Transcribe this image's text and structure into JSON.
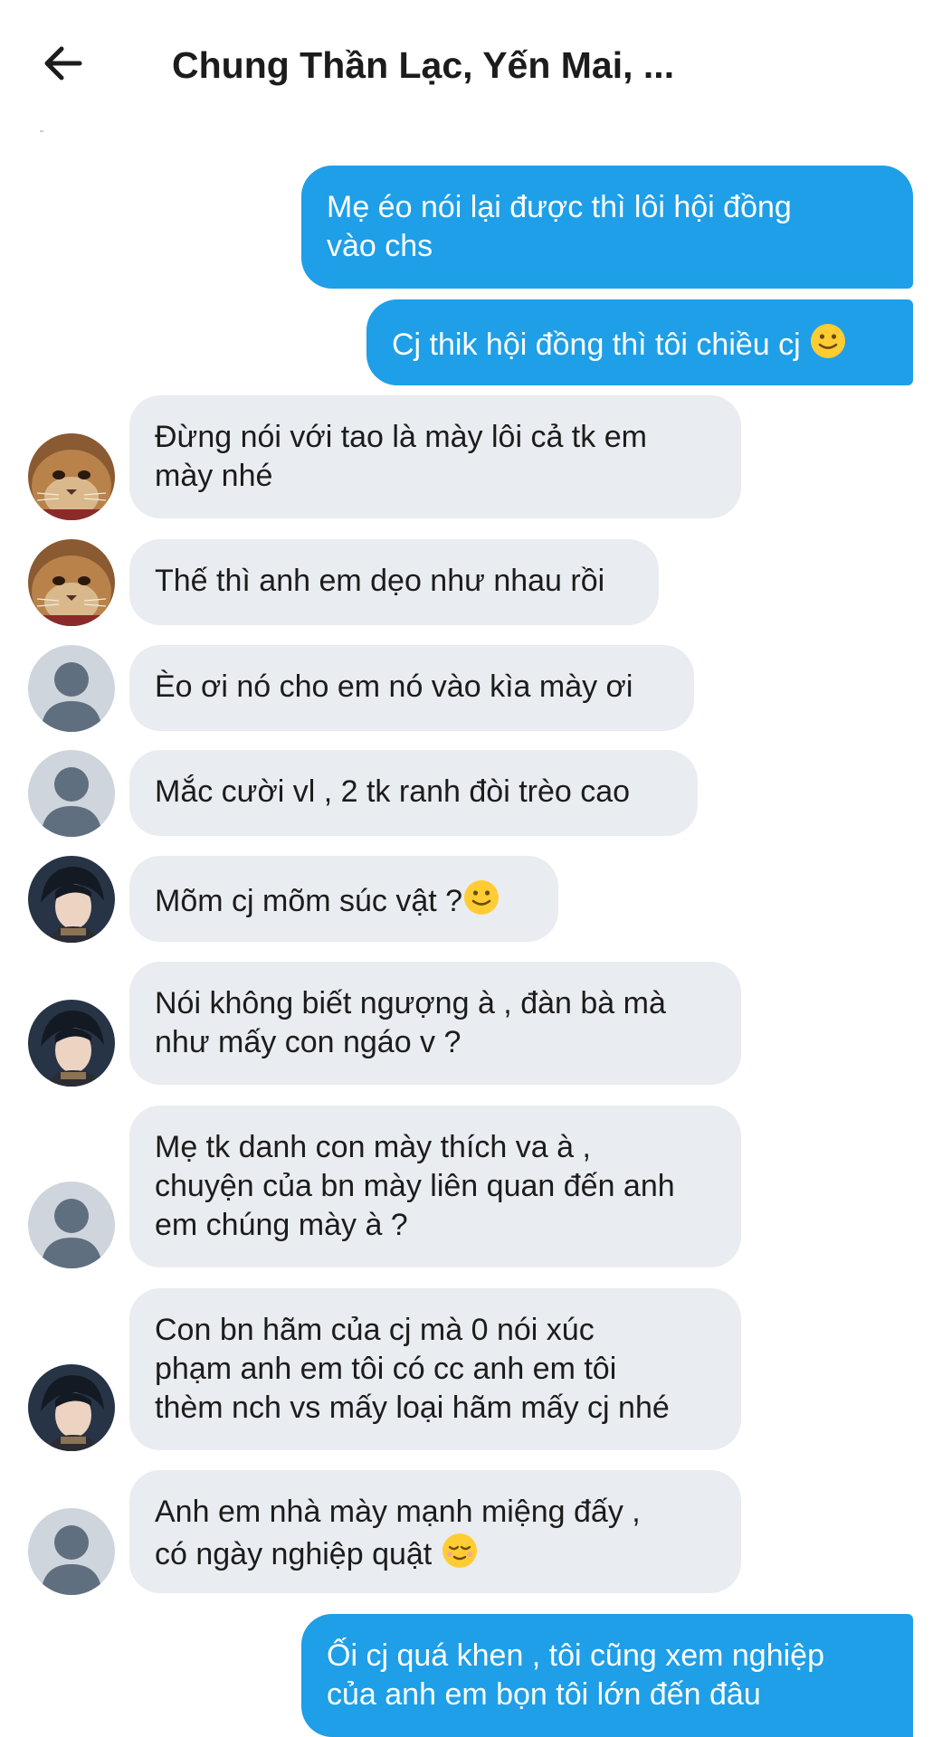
{
  "header": {
    "title": "Chung Thần Lạc, Yến Mai, ...",
    "back_icon": "arrow-left-icon"
  },
  "colors": {
    "outgoing_bubble": "#1e9fe8",
    "incoming_bubble": "#e9ecf0",
    "text_dark": "#1c1c1c",
    "text_light": "#ffffff"
  },
  "messages": [
    {
      "direction": "outgoing",
      "lines": [
        "Mẹ éo nói lại được thì lôi hội đồng",
        "vào chs"
      ]
    },
    {
      "direction": "outgoing",
      "lines": [
        "Cj thik hội đồng thì tôi chiều cj"
      ],
      "emoji": "slightly-smiling-face-icon"
    },
    {
      "direction": "incoming",
      "avatar": "cat-avatar",
      "lines": [
        "Đừng nói với tao là mày lôi cả tk em",
        "mày nhé"
      ]
    },
    {
      "direction": "incoming",
      "avatar": "cat-avatar",
      "lines": [
        "Thế thì anh em dẹo như nhau rồi"
      ]
    },
    {
      "direction": "incoming",
      "avatar": "default-avatar",
      "lines": [
        "Èo ơi nó cho em nó vào kìa mày ơi"
      ]
    },
    {
      "direction": "incoming",
      "avatar": "default-avatar",
      "lines": [
        "Mắc cười vl , 2 tk ranh đòi trèo cao"
      ]
    },
    {
      "direction": "incoming",
      "avatar": "photo-avatar",
      "lines": [
        "Mõm cj mõm súc vật ?"
      ],
      "emoji": "slightly-smiling-face-icon"
    },
    {
      "direction": "incoming",
      "avatar": "photo-avatar",
      "lines": [
        "Nói không biết ngượng à , đàn bà mà",
        "như mấy con ngáo v ?"
      ]
    },
    {
      "direction": "incoming",
      "avatar": "default-avatar",
      "lines": [
        "Mẹ tk danh con mày thích va à ,",
        "chuyện của bn mày liên quan đến anh",
        "em chúng mày à ?"
      ]
    },
    {
      "direction": "incoming",
      "avatar": "photo-avatar",
      "lines": [
        "Con bn hãm của cj mà 0 nói xúc",
        "phạm anh em tôi có cc anh em tôi",
        "thèm nch vs mấy loại hãm mấy cj nhé"
      ]
    },
    {
      "direction": "incoming",
      "avatar": "default-avatar",
      "lines": [
        "Anh em nhà mày mạnh miệng đấy ,",
        "có ngày nghiệp quật"
      ],
      "emoji": "relieved-face-icon"
    },
    {
      "direction": "outgoing",
      "lines": [
        "Ối cj quá khen , tôi cũng xem nghiệp",
        "của anh em bọn tôi lớn đến đâu"
      ]
    }
  ]
}
